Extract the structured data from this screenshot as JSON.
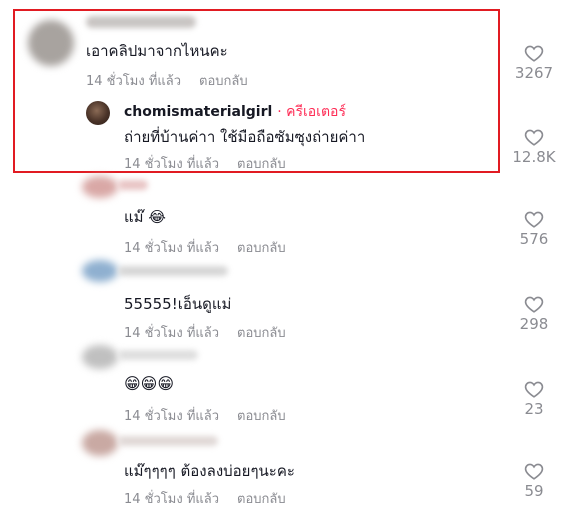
{
  "comments": [
    {
      "text": "เอาคลิปมาจากไหนคะ",
      "time": "14 ชั่วโมง ที่แล้ว",
      "reply": "ตอบกลับ",
      "likes": "3267",
      "avatar_color": "#a8a39f",
      "reply_thread": {
        "author": "chomismaterialgirl",
        "badge": "· ครีเอเตอร์",
        "text": "ถ่ายที่บ้านค่าา ใช้มือถือซัมซุงถ่ายค่าา",
        "time": "14 ชั่วโมง ที่แล้ว",
        "reply": "ตอบกลับ",
        "likes": "12.8K"
      }
    },
    {
      "text": "แม๊ 😂",
      "time": "14 ชั่วโมง ที่แล้ว",
      "reply": "ตอบกลับ",
      "likes": "576",
      "avatar_color": "#d9a8a6"
    },
    {
      "text": "55555!เอ็นดูแม่",
      "time": "14 ชั่วโมง ที่แล้ว",
      "reply": "ตอบกลับ",
      "likes": "298",
      "avatar_color": "#8fb0d0"
    },
    {
      "text": "😁😁😁",
      "time": "14 ชั่วโมง ที่แล้ว",
      "reply": "ตอบกลับ",
      "likes": "23",
      "avatar_color": "#c0c0c0"
    },
    {
      "text": "แม๊ๆๆๆๆ ต้องลงบ่อยๆนะคะ",
      "time": "14 ชั่วโมง ที่แล้ว",
      "reply": "ตอบกลับ",
      "likes": "59",
      "avatar_color": "#c9a9a3"
    }
  ],
  "colors": {
    "highlight": "#e11b22",
    "creator_badge": "#fe2c55",
    "meta": "#8a8b91"
  },
  "icons": {
    "like": "heart-outline-icon"
  }
}
